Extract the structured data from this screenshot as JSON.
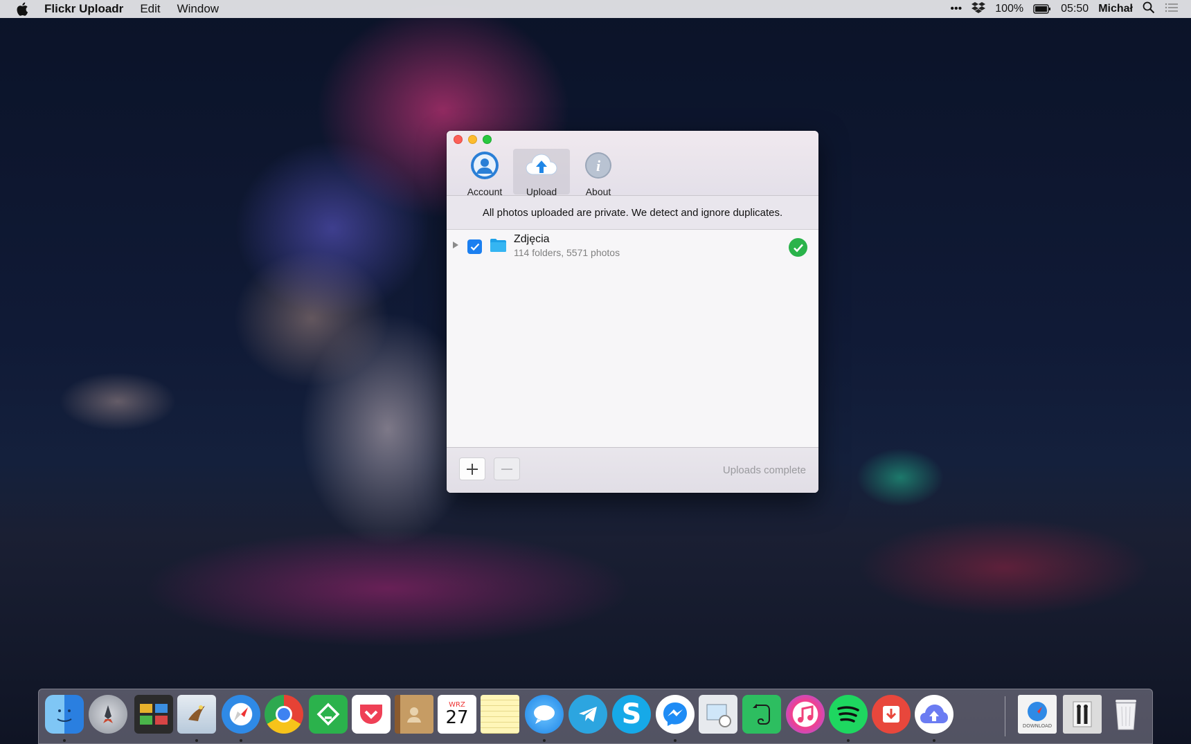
{
  "menubar": {
    "app_name": "Flickr Uploadr",
    "menus": [
      "Edit",
      "Window"
    ],
    "status_items": {
      "more": "•••",
      "battery_percent": "100%",
      "time": "05:50",
      "user": "Michał"
    }
  },
  "window": {
    "tabs": [
      {
        "label": "Account",
        "icon": "account-icon"
      },
      {
        "label": "Upload",
        "icon": "cloud-upload-icon"
      },
      {
        "label": "About",
        "icon": "info-icon"
      }
    ],
    "active_tab": "Upload",
    "info_text": "All photos uploaded are private. We detect and ignore duplicates.",
    "folders": [
      {
        "name": "Zdjęcia",
        "summary": "114 folders, 5571 photos",
        "checked": true,
        "status": "complete"
      }
    ],
    "buttons": {
      "add": "+",
      "remove": "—"
    },
    "status_text": "Uploads complete"
  },
  "dock": {
    "calendar": {
      "month": "WRZ",
      "day": "27"
    },
    "download_label": "DOWNLOAD",
    "apps": [
      "finder-icon",
      "launchpad-icon",
      "photo-theater-icon",
      "mail-icon",
      "safari-icon",
      "chrome-icon",
      "feedly-icon",
      "pocket-icon",
      "contacts-icon",
      "calendar-icon",
      "notes-icon",
      "messages-icon",
      "telegram-icon",
      "skype-icon",
      "messenger-icon",
      "preview-icon",
      "evernote-icon",
      "itunes-icon",
      "spotify-icon",
      "downloader-icon",
      "cloud-uploader-icon",
      "downloads-folder-icon",
      "documents-folder-icon",
      "trash-icon"
    ]
  },
  "colors": {
    "accent": "#1b7ff0",
    "success": "#2ab34a",
    "close": "#fc5f57",
    "minimize": "#fdbc2e",
    "zoom": "#28c840"
  }
}
